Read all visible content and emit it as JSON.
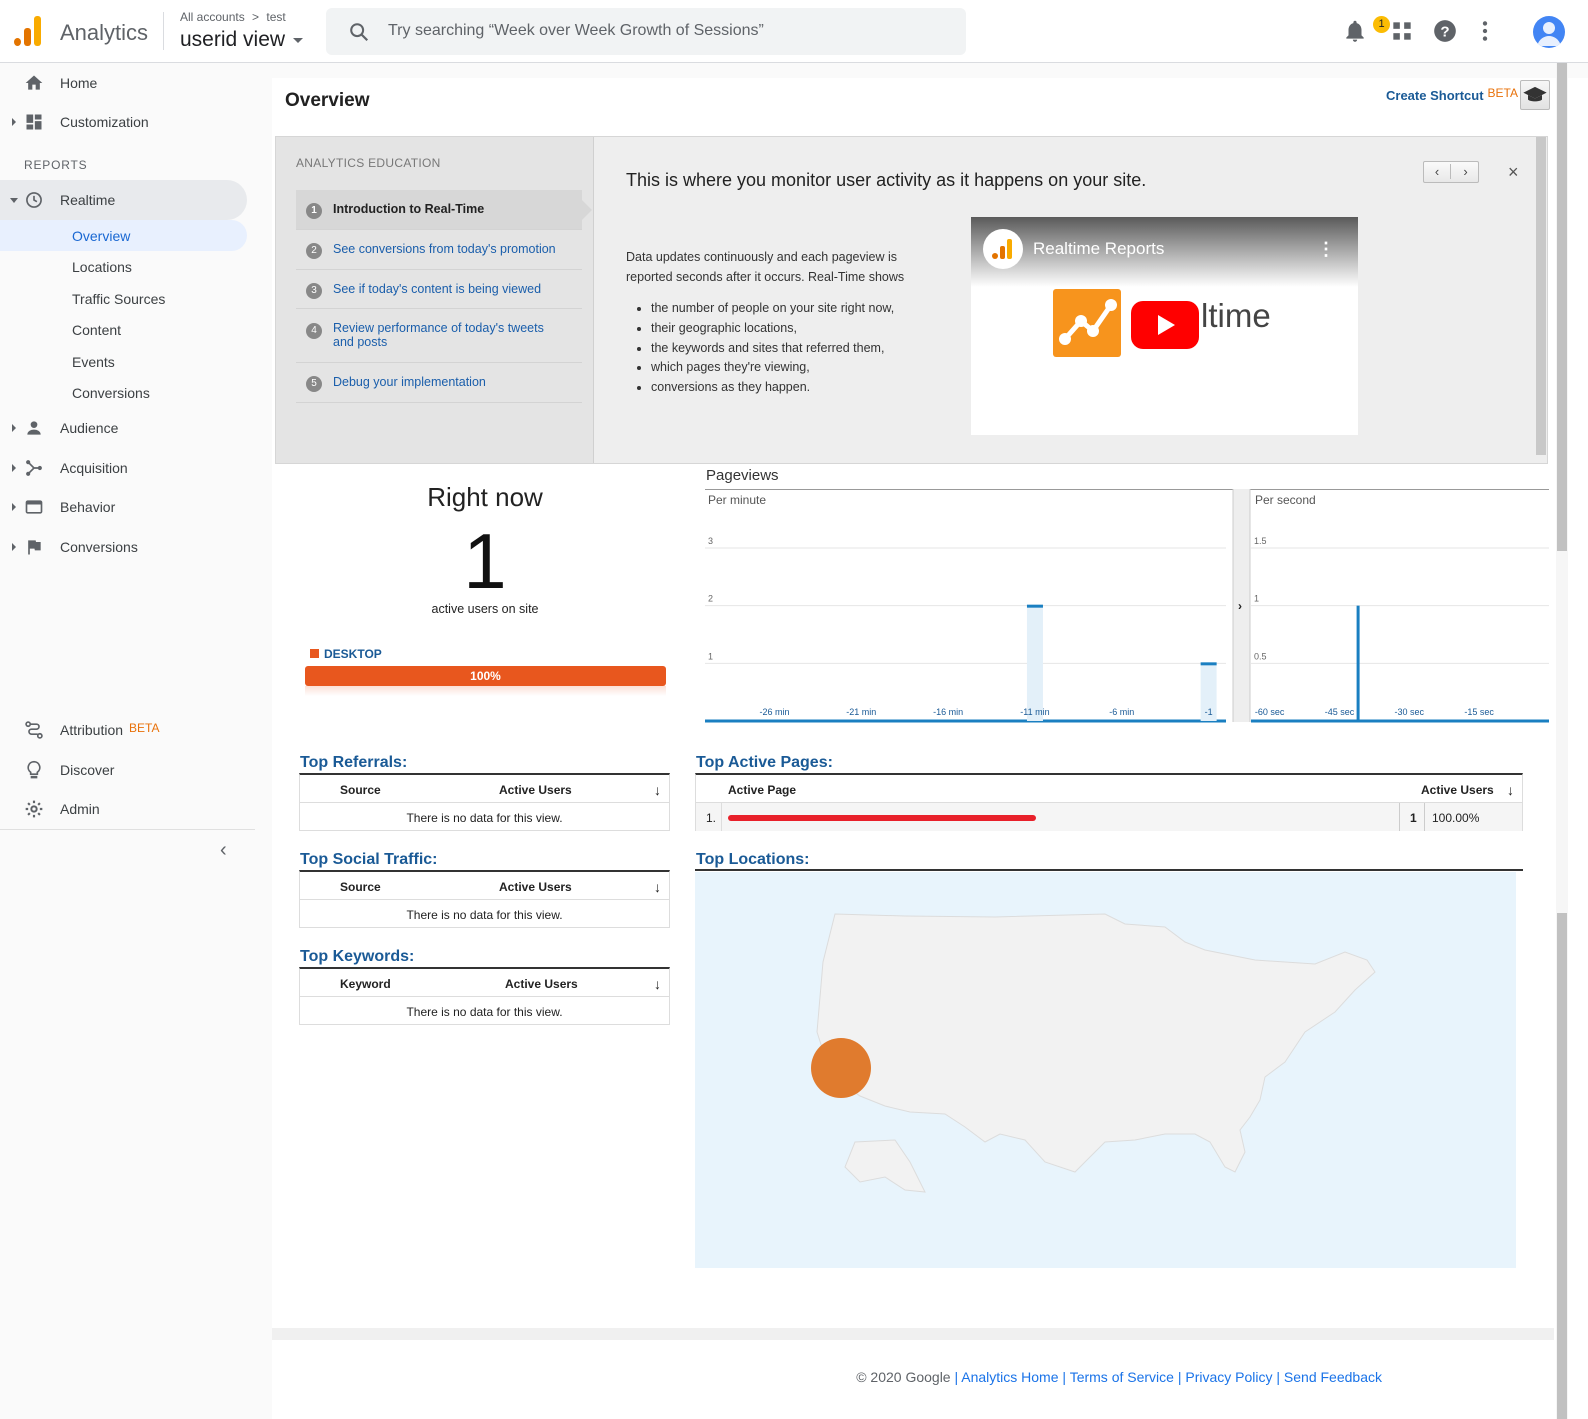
{
  "app": {
    "name": "Analytics",
    "breadcrumb": {
      "all_accounts": "All accounts",
      "separator": ">",
      "account": "test"
    },
    "view_name": "userid view",
    "logo_colors": [
      "#f9ab00",
      "#e37400",
      "#e37400"
    ]
  },
  "search": {
    "placeholder": "Try searching “Week over Week Growth of Sessions”"
  },
  "topbar": {
    "notification_count": "1",
    "icons": [
      "notifications-icon",
      "apps-icon",
      "help-icon",
      "more-vert-icon",
      "account-avatar"
    ]
  },
  "sidebar": {
    "home": "Home",
    "customization": "Customization",
    "reports_header": "REPORTS",
    "realtime": "Realtime",
    "realtime_items": [
      "Overview",
      "Locations",
      "Traffic Sources",
      "Content",
      "Events",
      "Conversions"
    ],
    "active_item": "Overview",
    "audience": "Audience",
    "acquisition": "Acquisition",
    "behavior": "Behavior",
    "conversions": "Conversions",
    "attribution": "Attribution",
    "attribution_badge": "BETA",
    "discover": "Discover",
    "admin": "Admin",
    "collapse": "‹"
  },
  "header": {
    "title": "Overview",
    "shortcut": "Create Shortcut",
    "shortcut_badge": "BETA"
  },
  "education": {
    "header": "ANALYTICS EDUCATION",
    "steps": [
      {
        "num": "1",
        "label": "Introduction to Real-Time"
      },
      {
        "num": "2",
        "label": "See conversions from today's promotion"
      },
      {
        "num": "3",
        "label": "See if today's content is being viewed"
      },
      {
        "num": "4",
        "label": "Review performance of today's tweets and posts"
      },
      {
        "num": "5",
        "label": "Debug your implementation"
      }
    ],
    "title": "This is where you monitor user activity as it happens on your site.",
    "body": "Data updates continuously and each pageview is reported seconds after it occurs. Real-Time shows",
    "bullets": [
      "the number of people on your site right now,",
      "their geographic locations,",
      "the keywords and sites that referred them,",
      "which pages they're viewing,",
      "conversions as they happen."
    ],
    "video_title": "Realtime Reports",
    "video_word": "ltime",
    "prev": "‹",
    "next": "›",
    "close": "×"
  },
  "right_now": {
    "title": "Right now",
    "count": "1",
    "subtitle": "active users on site",
    "device_label": "DESKTOP",
    "device_pct": "100%",
    "device_fraction": 1.0,
    "device_color": "#e8571e"
  },
  "pageviews": {
    "title": "Pageviews",
    "per_minute_label": "Per minute",
    "per_second_label": "Per second"
  },
  "chart_data": [
    {
      "type": "bar",
      "title": "Per minute",
      "ylim": [
        0,
        3
      ],
      "yticks": [
        "1",
        "2",
        "3"
      ],
      "xtick_labels": [
        "-26 min",
        "-21 min",
        "-16 min",
        "-11 min",
        "-6 min",
        "-1"
      ],
      "series": [
        {
          "x": [
            -11,
            -1
          ],
          "values": [
            2,
            1
          ]
        }
      ],
      "grid": true
    },
    {
      "type": "bar",
      "title": "Per second",
      "ylim": [
        0,
        1.5
      ],
      "yticks": [
        "0.5",
        "1",
        "1.5"
      ],
      "xtick_labels": [
        "-60 sec",
        "-45 sec",
        "-30 sec",
        "-15 sec"
      ],
      "series": [
        {
          "x": [
            -41
          ],
          "values": [
            1
          ]
        }
      ],
      "grid": true
    }
  ],
  "top_referrals": {
    "title": "Top Referrals:",
    "col1": "Source",
    "col2": "Active Users",
    "empty": "There is no data for this view."
  },
  "top_social": {
    "title": "Top Social Traffic:",
    "col1": "Source",
    "col2": "Active Users",
    "empty": "There is no data for this view."
  },
  "top_keywords": {
    "title": "Top Keywords:",
    "col1": "Keyword",
    "col2": "Active Users",
    "empty": "There is no data for this view."
  },
  "top_pages": {
    "title": "Top Active Pages:",
    "col1": "Active Page",
    "col2": "Active Users",
    "rows": [
      {
        "index": "1.",
        "users": "1",
        "pct": "100.00%"
      }
    ]
  },
  "top_locations": {
    "title": "Top Locations:",
    "bubble_color": "#e07b2e"
  },
  "footer": {
    "copyright": "© 2020 Google",
    "links": [
      "Analytics Home",
      "Terms of Service",
      "Privacy Policy",
      "Send Feedback"
    ],
    "sep": "|"
  }
}
